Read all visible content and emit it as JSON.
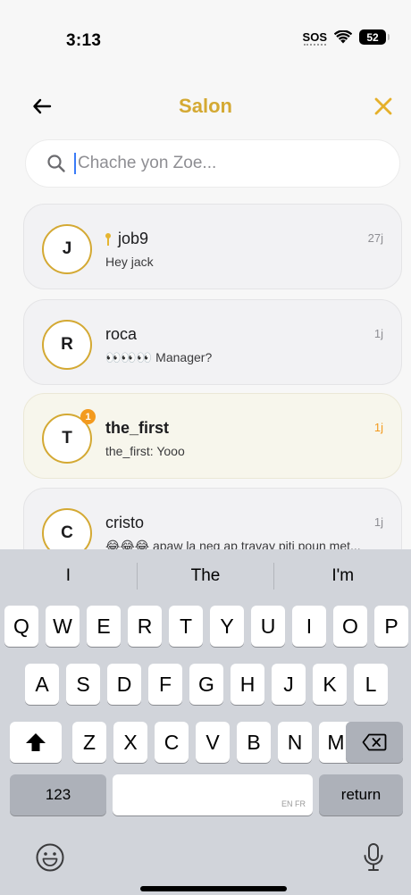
{
  "status_bar": {
    "time": "3:13",
    "sos": "SOS",
    "battery": "52"
  },
  "header": {
    "title": "Salon",
    "back_icon": "arrow-left-icon",
    "close_icon": "close-icon",
    "accent_color": "#d4a933"
  },
  "search": {
    "placeholder": "Chache yon Zoe..."
  },
  "chats": [
    {
      "initial": "J",
      "name": "job9",
      "pinned": true,
      "preview": "Hey jack",
      "time": "27j",
      "unread": false
    },
    {
      "initial": "R",
      "name": "roca",
      "pinned": false,
      "preview": "👀👀👀 Manager?",
      "time": "1j",
      "unread": false
    },
    {
      "initial": "T",
      "name": "the_first",
      "pinned": false,
      "preview": "the_first: Yooo",
      "time": "1j",
      "unread": true,
      "badge": "1"
    },
    {
      "initial": "C",
      "name": "cristo",
      "pinned": false,
      "preview": "😂😂😂 apaw la neg ap travay piti poun met...",
      "time": "1j",
      "unread": false
    }
  ],
  "keyboard": {
    "suggestions": [
      "I",
      "The",
      "I'm"
    ],
    "row1": [
      "Q",
      "W",
      "E",
      "R",
      "T",
      "Y",
      "U",
      "I",
      "O",
      "P"
    ],
    "row2": [
      "A",
      "S",
      "D",
      "F",
      "G",
      "H",
      "J",
      "K",
      "L"
    ],
    "row3": [
      "Z",
      "X",
      "C",
      "V",
      "B",
      "N",
      "M"
    ],
    "numbers_label": "123",
    "space_hint": "EN FR",
    "return_label": "return"
  }
}
